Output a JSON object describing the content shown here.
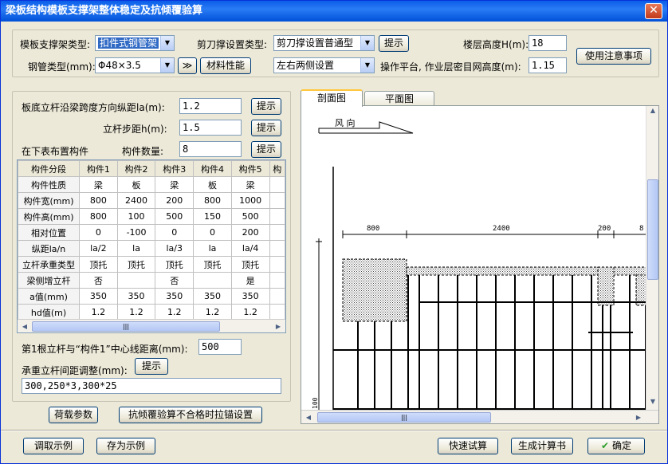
{
  "window": {
    "title": "梁板结构模板支撑架整体稳定及抗倾覆验算",
    "close_glyph": "✕"
  },
  "top": {
    "support_type_label": "模板支撑架类型:",
    "support_type_value": "扣件式钢管架",
    "steel_type_label": "钢管类型(mm):",
    "steel_type_value": "Φ48×3.5",
    "double_arrow_glyph": "≫",
    "material_button": "材料性能",
    "scissor_label": "剪刀撑设置类型:",
    "scissor_value": "剪刀撑设置普通型",
    "hint_button": "提示",
    "side_value": "左右两侧设置",
    "floor_height_label": "楼层高度H(m):",
    "floor_height_value": "18",
    "platform_label": "操作平台, 作业层密目网高度(m):",
    "platform_value": "1.15",
    "notes_button": "使用注意事项"
  },
  "left": {
    "span_label": "板底立杆沿梁跨度方向纵距la(m):",
    "span_value": "1.2",
    "step_label": "立杆步距h(m):",
    "step_value": "1.5",
    "hint_button": "提示",
    "arrange_label": "在下表布置构件",
    "count_label": "构件数量:",
    "count_value": "8",
    "table": {
      "headers": [
        "构件分段",
        "构件1",
        "构件2",
        "构件3",
        "构件4",
        "构件5",
        "构"
      ],
      "rows": [
        [
          "构件性质",
          "梁",
          "板",
          "梁",
          "板",
          "梁",
          ""
        ],
        [
          "构件宽(mm)",
          "800",
          "2400",
          "200",
          "800",
          "1000",
          ""
        ],
        [
          "构件高(mm)",
          "800",
          "100",
          "500",
          "150",
          "500",
          ""
        ],
        [
          "相对位置",
          "0",
          "-100",
          "0",
          "0",
          "200",
          ""
        ],
        [
          "纵距la/n",
          "la/2",
          "la",
          "la/3",
          "la",
          "la/4",
          ""
        ],
        [
          "立杆承重类型",
          "顶托",
          "顶托",
          "顶托",
          "顶托",
          "顶托",
          ""
        ],
        [
          "梁侧增立杆",
          "否",
          "",
          "否",
          "",
          "是",
          ""
        ],
        [
          "a值(mm)",
          "350",
          "350",
          "350",
          "350",
          "350",
          ""
        ],
        [
          "hd值(m)",
          "1.2",
          "1.2",
          "1.2",
          "1.2",
          "1.2",
          ""
        ]
      ]
    },
    "first_pole_label": "第1根立杆与“构件1”中心线距离(mm):",
    "first_pole_value": "500",
    "adjust_label": "承重立杆间距调整(mm):",
    "adjust_value": "300,250*3,300*25",
    "load_button": "荷载参数",
    "anchor_button": "抗倾覆验算不合格时拉锚设置"
  },
  "right": {
    "tab_section": "剖面图",
    "tab_plan": "平面图",
    "wind_label": "风  向",
    "dims": [
      "800",
      "2400",
      "200",
      "8"
    ],
    "axis_label": "100"
  },
  "bottom": {
    "load_example": "调取示例",
    "save_example": "存为示例",
    "quick_calc": "快速试算",
    "gen_report": "生成计算书",
    "ok": "确定",
    "ok_icon": "✔"
  }
}
